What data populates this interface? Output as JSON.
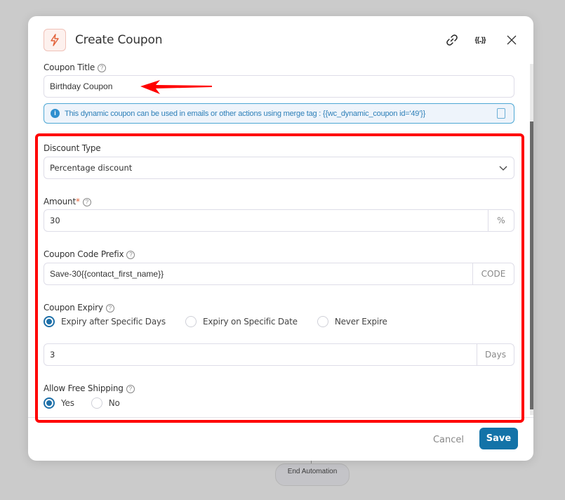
{
  "background": {
    "node_label": "End Automation"
  },
  "modal": {
    "title": "Create Coupon",
    "header_icons": [
      "lightning-icon",
      "link-icon",
      "merge-tag-icon",
      "close-icon"
    ],
    "merge_tag_glyph": "{{..}}",
    "close_glyph": "✕"
  },
  "coupon_title": {
    "label": "Coupon Title",
    "value": "Birthday Coupon"
  },
  "info": {
    "text": "This dynamic coupon can be used in emails or other actions using merge tag : {{wc_dynamic_coupon id='49'}}"
  },
  "discount_type": {
    "label": "Discount Type",
    "selected": "Percentage discount"
  },
  "amount": {
    "label": "Amount",
    "required_mark": "*",
    "value": "30",
    "suffix": "%"
  },
  "coupon_code_prefix": {
    "label": "Coupon Code Prefix",
    "value": "Save-30{{contact_first_name}}",
    "suffix": "CODE"
  },
  "coupon_expiry": {
    "label": "Coupon Expiry",
    "options": [
      {
        "label": "Expiry after Specific Days",
        "selected": true
      },
      {
        "label": "Expiry on Specific Date",
        "selected": false
      },
      {
        "label": "Never Expire",
        "selected": false
      }
    ],
    "days_value": "3",
    "days_suffix": "Days"
  },
  "free_shipping": {
    "label": "Allow Free Shipping",
    "options": [
      {
        "label": "Yes",
        "selected": true
      },
      {
        "label": "No",
        "selected": false
      }
    ]
  },
  "footer": {
    "cancel_label": "Cancel",
    "save_label": "Save"
  },
  "colors": {
    "primary": "#1373a8",
    "annotation": "#ff0000",
    "info": "#2d7fb8",
    "brand_icon": "#e2623a"
  },
  "help_glyph": "?",
  "info_glyph": "i"
}
